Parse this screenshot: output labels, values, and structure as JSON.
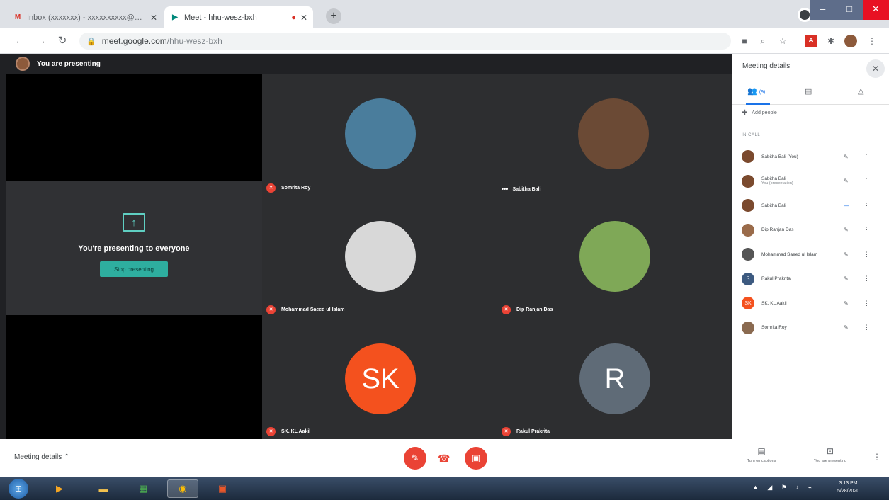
{
  "browser": {
    "tabs": [
      {
        "title": "Inbox (xxxxxxx) - xxxxxxxxxx@gmail.com",
        "favicon": "gmail-icon",
        "active": false
      },
      {
        "title": "Meet - hhu-wesz-bxh",
        "favicon": "meet-icon",
        "active": true
      }
    ],
    "new_tab_symbol": "+",
    "url_host": "meet.google.com",
    "url_path": "/hhu-wesz-bxh",
    "window_controls": {
      "minimize": "–",
      "maximize": "□",
      "close": "✕"
    }
  },
  "presenting_bar": {
    "text": "You are presenting"
  },
  "present_panel": {
    "message": "You're presenting to everyone",
    "stop_button": "Stop presenting",
    "icon_symbol": "↑"
  },
  "participants_grid": [
    {
      "name": "Somrita Roy",
      "type": "photo",
      "color": "#4a7d9c",
      "initials": ""
    },
    {
      "name": "Sabitha Bali",
      "type": "photo",
      "color": "#6b4a35",
      "initials": ""
    },
    {
      "name": "Mohammad Saeed ul Islam",
      "type": "photo",
      "color": "#d8d8d8",
      "initials": ""
    },
    {
      "name": "Dip Ranjan Das",
      "type": "photo",
      "color": "#7fa857",
      "initials": ""
    },
    {
      "name": "SK. KL Aakil",
      "type": "initials",
      "color": "#f4511e",
      "initials": "SK"
    },
    {
      "name": "Rakul Prakrita",
      "type": "initials",
      "color": "#5f6b77",
      "initials": "R"
    }
  ],
  "grid_extras": {
    "dots_label": "•••"
  },
  "side_panel": {
    "title": "Meeting details",
    "close_symbol": "✕",
    "tabs": [
      {
        "label": "(9)",
        "icon": "people-icon"
      },
      {
        "label": "",
        "icon": "chat-icon"
      },
      {
        "label": "",
        "icon": "activities-icon"
      }
    ],
    "add_people": "Add people",
    "section_label": "IN CALL",
    "participants": [
      {
        "name": "Sabitha Bali (You)",
        "sub": "",
        "color": "#7b4a2e",
        "initials": "",
        "mic": "✎",
        "more": "⋮"
      },
      {
        "name": "Sabitha Bali",
        "sub": "You (presentation)",
        "color": "#7b4a2e",
        "initials": "",
        "mic": "✎",
        "more": "⋮"
      },
      {
        "name": "Sabitha Bali",
        "sub": "",
        "color": "#7b4a2e",
        "initials": "",
        "mic": "—",
        "more": "⋮"
      },
      {
        "name": "Dip Ranjan Das",
        "sub": "",
        "color": "#9a6b4a",
        "initials": "",
        "mic": "✎",
        "more": "⋮"
      },
      {
        "name": "Mohammad Saeed ul Islam",
        "sub": "",
        "color": "#555555",
        "initials": "",
        "mic": "✎",
        "more": "⋮"
      },
      {
        "name": "Rakul Prakrita",
        "sub": "",
        "color": "#3d5a80",
        "initials": "R",
        "mic": "✎",
        "more": "⋮"
      },
      {
        "name": "SK. KL Aakil",
        "sub": "",
        "color": "#f4511e",
        "initials": "SK",
        "mic": "✎",
        "more": "⋮"
      },
      {
        "name": "Somrita Roy",
        "sub": "",
        "color": "#8a6a50",
        "initials": "",
        "mic": "✎",
        "more": "⋮"
      }
    ]
  },
  "bottom_bar": {
    "meeting_details": "Meeting details ⌃",
    "mic_symbol": "✎",
    "hangup_symbol": "☎",
    "camera_symbol": "▣",
    "captions_label": "Turn on captions",
    "presenting_label": "You are presenting",
    "more_symbol": "⋮"
  },
  "taskbar": {
    "start_symbol": "⊞",
    "tray": "▲ ◢ ⚑ ♪ ⌁",
    "time": "3:13 PM",
    "date": "5/28/2020"
  }
}
